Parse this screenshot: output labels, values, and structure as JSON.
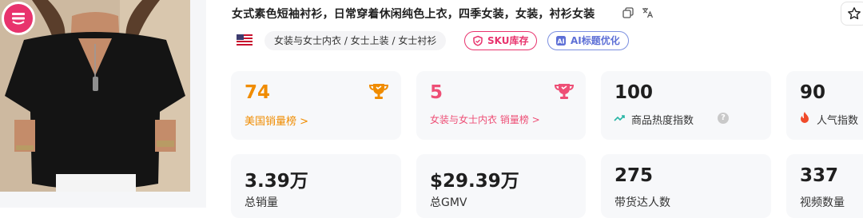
{
  "product": {
    "title": "女式素色短袖衬衫，日常穿着休闲纯色上衣，四季女装，女装，衬衫女装",
    "category_path": "女装与女士内衣 / 女士上装 / 女士衬衫",
    "chips": {
      "sku_label": "SKU库存",
      "ai_label": "AI标题优化"
    }
  },
  "icons": {
    "copy": "copy-icon",
    "translate": "translate-icon",
    "star": "star-icon",
    "flag": "us-flag-icon",
    "trophy": "trophy-icon",
    "trend": "trend-icon",
    "help": "help-icon",
    "fire": "fire-icon",
    "shop": "shop-badge-icon"
  },
  "colors": {
    "orange": "#f08c00",
    "pink": "#ee4f76",
    "brand": "#e8336d",
    "ai": "#5d6fd6"
  },
  "rank_cards": [
    {
      "value": "74",
      "label": "美国销量榜 >"
    },
    {
      "value": "5",
      "label": "女装与女士内衣 销量榜 >"
    },
    {
      "value": "100",
      "label": "商品热度指数"
    },
    {
      "value": "90",
      "label": "人气指数"
    }
  ],
  "stat_cards": [
    {
      "value": "3.39万",
      "label": "总销量"
    },
    {
      "value": "$29.39万",
      "label": "总GMV"
    },
    {
      "value": "275",
      "label": "带货达人数"
    },
    {
      "value": "337",
      "label": "视频数量"
    }
  ]
}
